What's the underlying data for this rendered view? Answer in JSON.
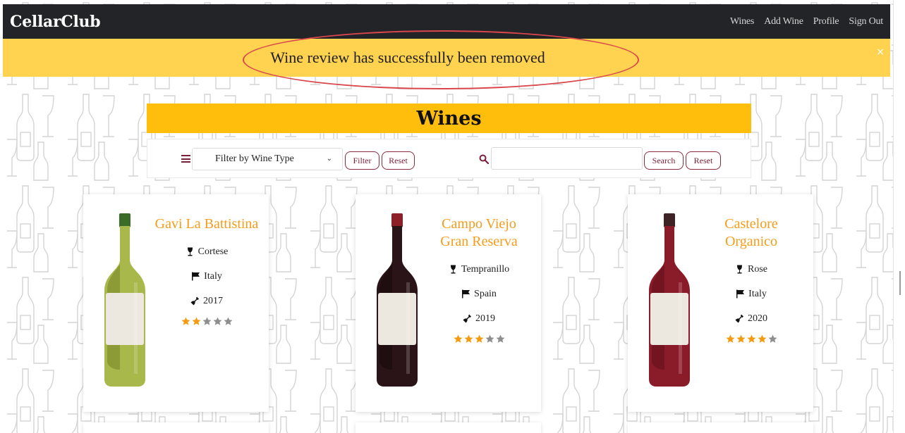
{
  "navbar": {
    "brand": "CellarClub",
    "links": [
      "Wines",
      "Add Wine",
      "Profile",
      "Sign Out"
    ]
  },
  "alert": {
    "message": "Wine review has successfully been removed",
    "close": "×"
  },
  "page": {
    "title": "Wines"
  },
  "filter": {
    "select_value": "Filter by Wine Type",
    "filter_button": "Filter",
    "reset_button": "Reset",
    "search_placeholder": "",
    "search_button": "Search",
    "search_reset_button": "Reset"
  },
  "colors": {
    "accent": "#ffbe0b",
    "alert": "#ffd34f",
    "wine_name": "#f59c1a",
    "button": "#7b1f37",
    "star_on": "#f39c12",
    "star_off": "#8e8e8e"
  },
  "wines": [
    {
      "name": "Gavi La Battistina",
      "grape": "Cortese",
      "country": "Italy",
      "year": "2017",
      "rating": 2,
      "bottle": "white-wine-bottle-icon"
    },
    {
      "name": "Campo Viejo Gran Reserva",
      "grape": "Tempranillo",
      "country": "Spain",
      "year": "2019",
      "rating": 3,
      "bottle": "red-wine-bottle-icon"
    },
    {
      "name": "Castelore Organico",
      "grape": "Rose",
      "country": "Italy",
      "year": "2020",
      "rating": 4,
      "bottle": "rose-wine-bottle-icon"
    }
  ]
}
